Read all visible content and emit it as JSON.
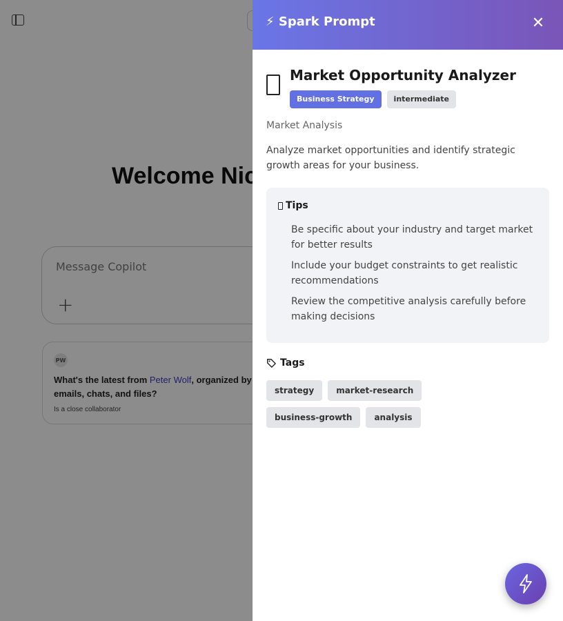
{
  "background": {
    "welcome_text": "Welcome Nick",
    "composer_placeholder": "Message Copilot",
    "composer_plus": "+",
    "suggestion": {
      "avatar_initials": "PW",
      "question_before": "What's the latest from ",
      "person_link": "Peter Wolf",
      "question_after": ", organized by emails, chats, and files?",
      "subtitle": "Is a close collaborator"
    }
  },
  "panel": {
    "header_title": "⚡ Spark Prompt",
    "close_symbol": "✕",
    "prompt": {
      "icon": "document-icon",
      "name": "Market Opportunity Analyzer",
      "category": "Business Strategy",
      "level": "intermediate",
      "subcategory": "Market Analysis",
      "description": "Analyze market opportunities and identify strategic growth areas for your business."
    },
    "tips": {
      "title": "Tips",
      "items": [
        "Be specific about your industry and target market for better results",
        "Include your budget constraints to get realistic recommendations",
        "Review the competitive analysis carefully before making decisions"
      ]
    },
    "tags": {
      "title": "Tags",
      "items": [
        "strategy",
        "market-research",
        "business-growth",
        "analysis"
      ]
    }
  },
  "colors": {
    "header_gradient_start": "#6a76e6",
    "header_gradient_end": "#7a55b8",
    "category_badge": "#6270e4",
    "fab": "#6a4fc8"
  }
}
